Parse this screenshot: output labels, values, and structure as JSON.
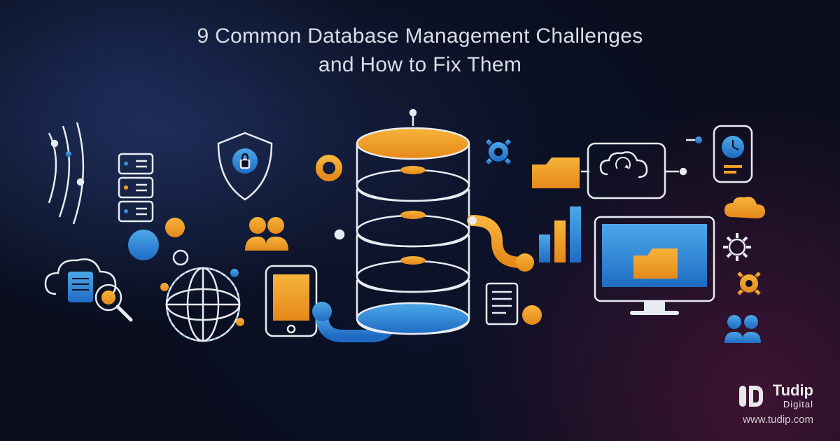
{
  "title_line1": "9 Common Database Management Challenges",
  "title_line2": "and How to Fix Them",
  "brand": {
    "name": "Tudip",
    "tagline": "Digital",
    "url": "www.tudip.com"
  },
  "colors": {
    "orange": "#f29a1f",
    "blue": "#2a7fd4",
    "light_blue": "#4ca8e8",
    "stroke": "#e8ecf2",
    "bg_dark": "#0a0e1f"
  },
  "icons": [
    "database-stack",
    "security-shield",
    "lock",
    "globe",
    "magnifier",
    "cloud-document",
    "server-rack",
    "users",
    "tablet",
    "monitor",
    "folder",
    "sync-cloud",
    "gear",
    "bar-chart",
    "network-lines",
    "clock-device"
  ]
}
